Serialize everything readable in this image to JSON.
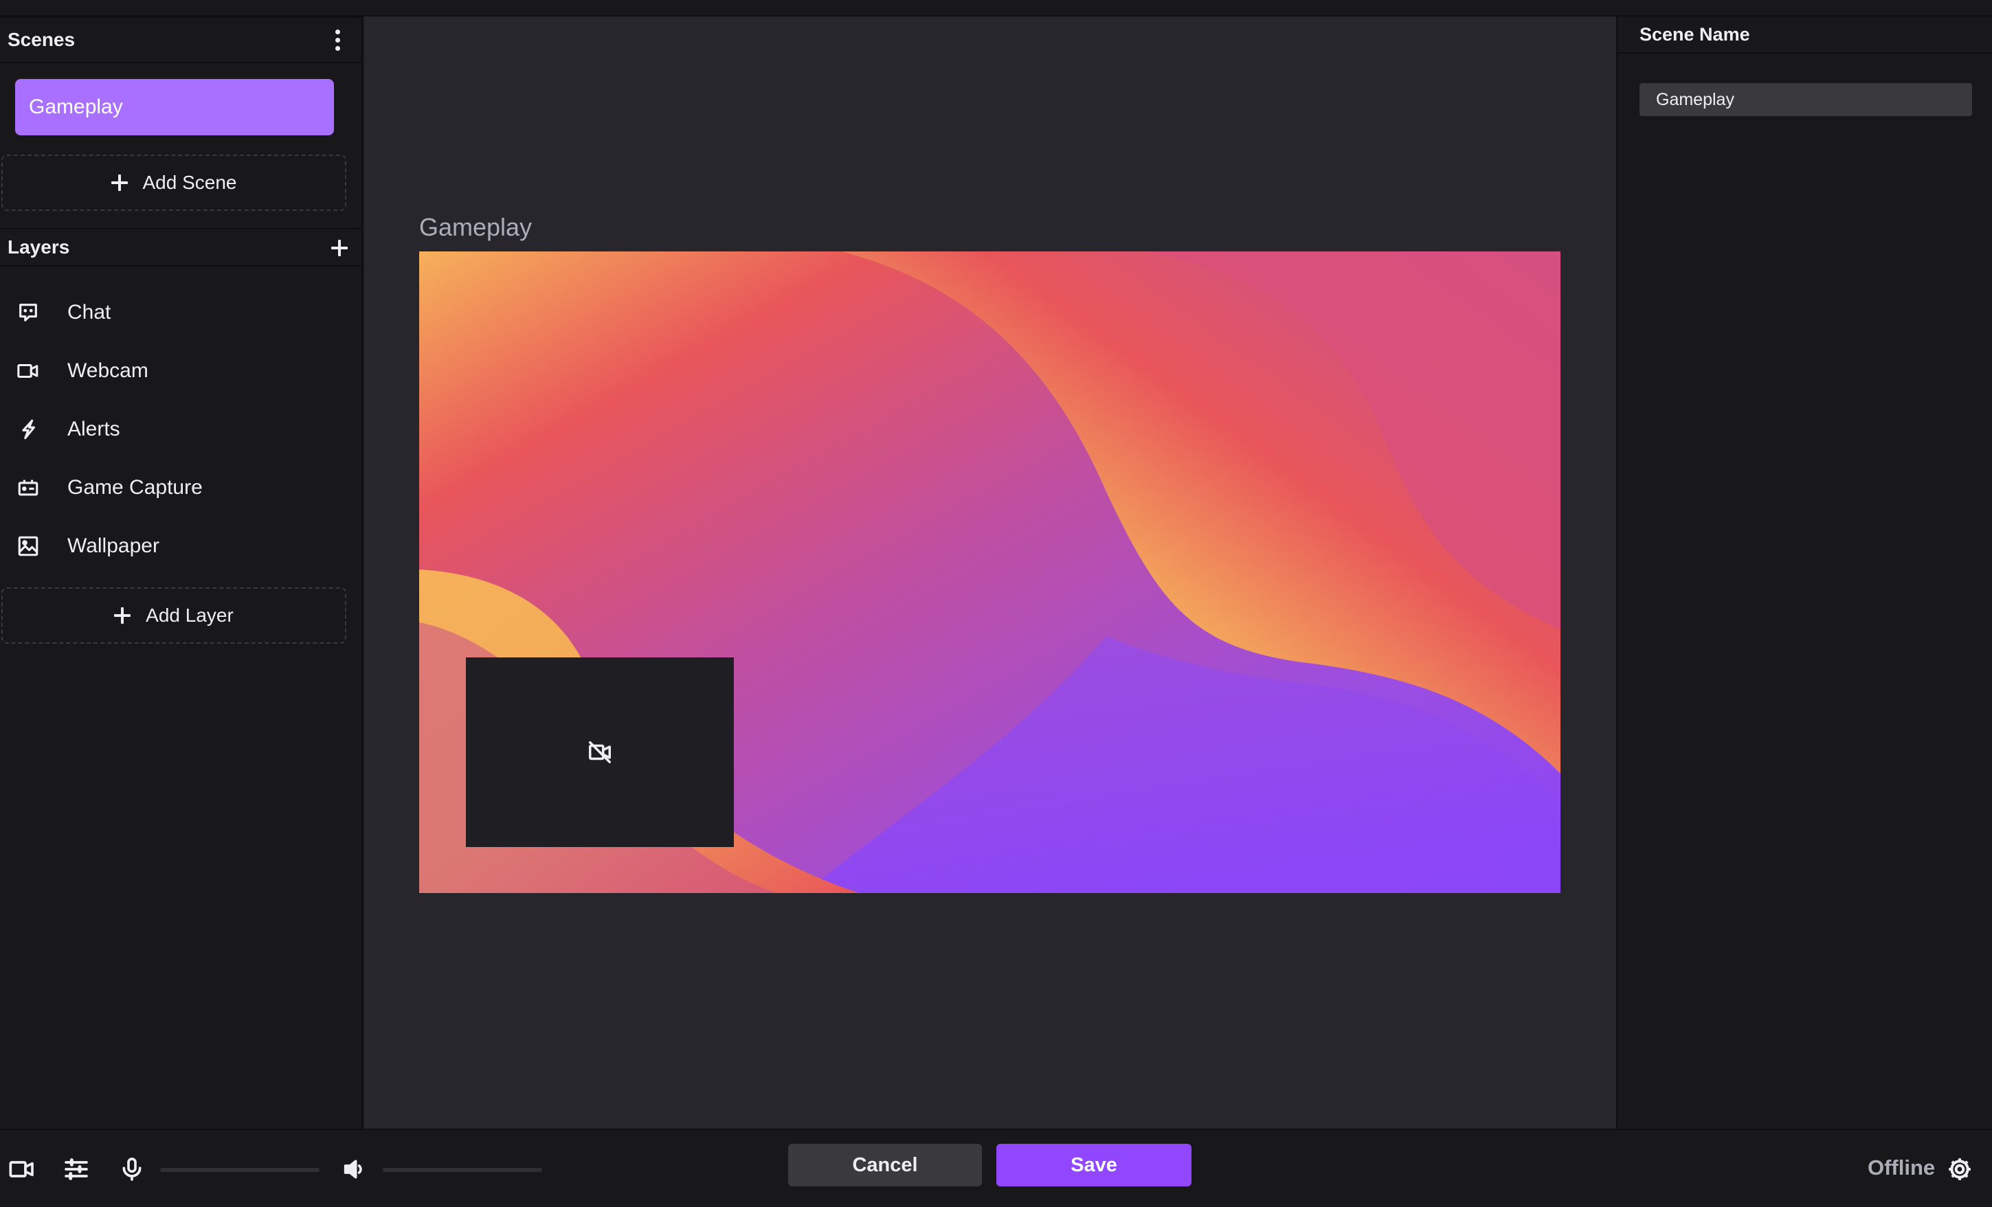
{
  "scenes": {
    "title": "Scenes",
    "items": [
      {
        "label": "Gameplay"
      }
    ],
    "add_label": "Add Scene"
  },
  "layers": {
    "title": "Layers",
    "items": [
      {
        "label": "Chat",
        "icon": "chat-icon"
      },
      {
        "label": "Webcam",
        "icon": "webcam-icon"
      },
      {
        "label": "Alerts",
        "icon": "alerts-icon"
      },
      {
        "label": "Game Capture",
        "icon": "game-capture-icon"
      },
      {
        "label": "Wallpaper",
        "icon": "wallpaper-icon"
      }
    ],
    "add_label": "Add Layer"
  },
  "canvas": {
    "scene_title": "Gameplay",
    "webcam_placeholder_icon": "camera-off-icon"
  },
  "properties": {
    "field_label": "Scene Name",
    "scene_name_value": "Gameplay"
  },
  "bottom_bar": {
    "icons": [
      "camera-icon",
      "sliders-icon",
      "microphone-icon",
      "speaker-icon"
    ],
    "cancel_label": "Cancel",
    "save_label": "Save",
    "status": "Offline"
  },
  "colors": {
    "accent": "#9147ff",
    "selected_scene": "#a970ff",
    "background": "#18181b",
    "canvas_area": "#26262c"
  }
}
